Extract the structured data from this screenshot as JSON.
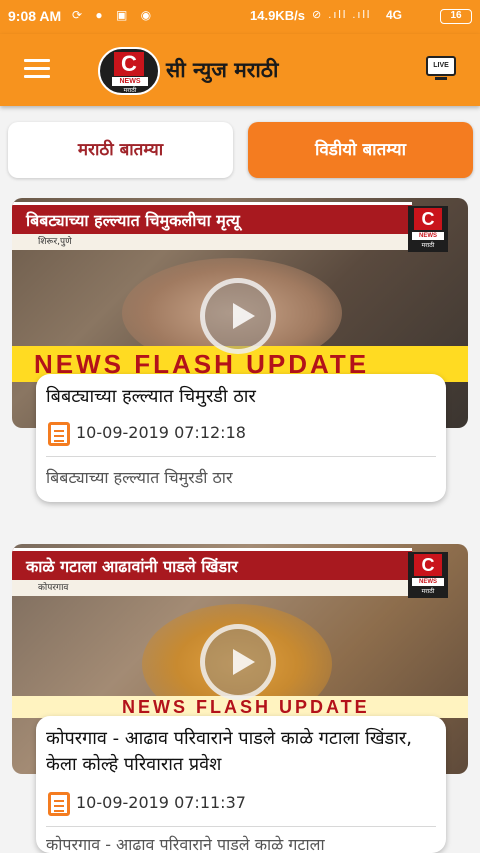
{
  "status_bar": {
    "time": "9:08 AM",
    "left_icons": "⟳ ● ▣ ◉",
    "speed": "14.9KB/s",
    "signal": "⊘ .ıll .ıll",
    "network": "4G",
    "battery": "16"
  },
  "app_bar": {
    "menu_icon": "hamburger-icon",
    "logo_letter": "C",
    "logo_news": "NEWS",
    "logo_sub": "मराठी",
    "title": "सी न्युज मराठी",
    "live_label": "LIVE"
  },
  "tabs": [
    {
      "label": "मराठी बातम्या",
      "selected": false
    },
    {
      "label": "विडीयो बातम्या",
      "selected": true
    }
  ],
  "videos": [
    {
      "thumb_headline": "बिबट्याच्या हल्ल्यात चिमुकलीचा मृत्यू",
      "thumb_location": "शिरूर,पुणे",
      "thumb_banner": "NEWS FLASH UPDATE",
      "title": "बिबट्याच्या हल्ल्यात चिमुरडी ठार",
      "date": "10-09-2019 07:12:18",
      "description": "बिबट्याच्या हल्ल्यात चिमुरडी ठार"
    },
    {
      "thumb_headline": "काळे गटाला आढावांनी पाडले खिंडार",
      "thumb_location": "कोपरगाव",
      "thumb_banner": "NEWS FLASH UPDATE",
      "title": "कोपरगाव - आढाव परिवाराने पाडले काळे गटाला खिंडार, केला कोल्हे परिवारात प्रवेश",
      "date": "10-09-2019 07:11:37",
      "description": "कोपरगाव - आढाव परिवाराने पाडले काळे गटाला"
    }
  ],
  "colors": {
    "brand_orange": "#f7931e",
    "tab_active": "#f47c20",
    "tab_inactive_text": "#a0242a",
    "channel_red": "#c9141b"
  }
}
